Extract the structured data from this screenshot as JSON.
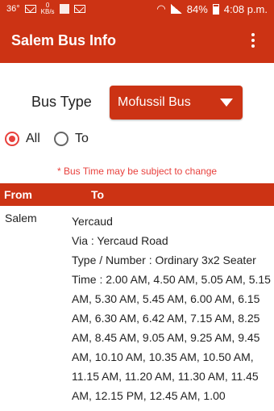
{
  "status_bar": {
    "temp": "36°",
    "kbs_top": "0",
    "kbs_bottom": "KB/s",
    "battery": "84%",
    "time": "4:08 p.m."
  },
  "app_bar": {
    "title": "Salem Bus Info",
    "menu_icon": "overflow-menu-icon"
  },
  "bus_type": {
    "label": "Bus Type",
    "selected": "Mofussil Bus"
  },
  "filter": {
    "all_label": "All",
    "to_label": "To",
    "selected": "All"
  },
  "notice": "* Bus Time may be subject to change",
  "table": {
    "headers": {
      "from": "From",
      "to": "To"
    },
    "rows": [
      {
        "from": "Salem",
        "to": "Yercaud",
        "via": "Via : Yercaud Road",
        "type": "Type / Number :  Ordinary 3x2 Seater",
        "time": "Time : 2.00 AM, 4.50 AM, 5.05 AM, 5.15 AM, 5.30 AM, 5.45 AM, 6.00 AM, 6.15 AM, 6.30 AM, 6.42 AM, 7.15 AM, 8.25 AM, 8.45 AM, 9.05 AM, 9.25 AM, 9.45 AM, 10.10 AM, 10.35 AM, 10.50 AM, 11.15 AM, 11.20 AM, 11.30 AM, 11.45 AM, 12.15 PM, 12.45 AM, 1.00"
      }
    ]
  },
  "colors": {
    "primary": "#cc3314",
    "accent": "#e8413d"
  }
}
